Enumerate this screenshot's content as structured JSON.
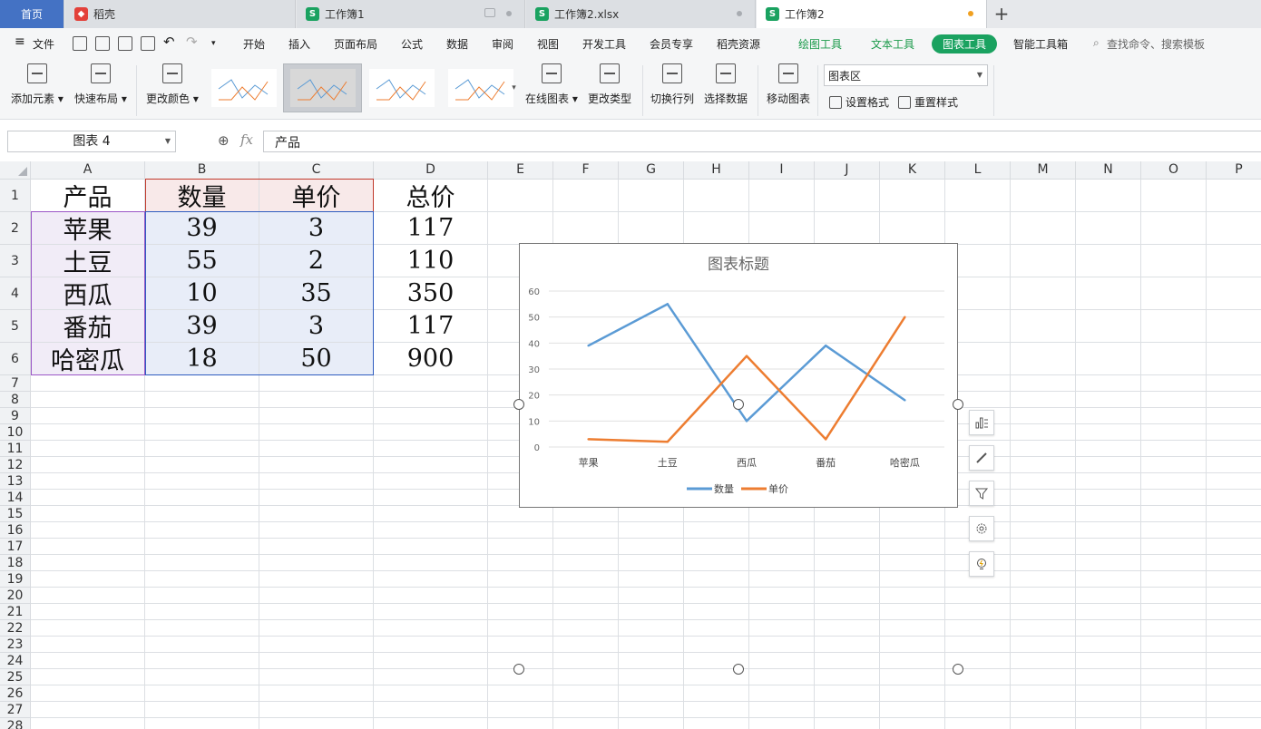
{
  "tabs": [
    {
      "label": "首页"
    },
    {
      "label": "稻壳"
    },
    {
      "label": "工作簿1"
    },
    {
      "label": "工作簿2.xlsx"
    },
    {
      "label": "工作簿2"
    }
  ],
  "menu": {
    "file": "文件",
    "items": [
      "开始",
      "插入",
      "页面布局",
      "公式",
      "数据",
      "审阅",
      "视图",
      "开发工具",
      "会员专享",
      "稻壳资源"
    ],
    "context": [
      "绘图工具",
      "文本工具",
      "图表工具"
    ],
    "smart": "智能工具箱",
    "search": "查找命令、搜索模板"
  },
  "ribbon": {
    "add_element": "添加元素",
    "quick_layout": "快速布局",
    "change_color": "更改颜色",
    "online_chart": "在线图表",
    "change_type": "更改类型",
    "switch_rowcol": "切换行列",
    "select_data": "选择数据",
    "move_chart": "移动图表",
    "chart_area": "图表区",
    "set_format": "设置格式",
    "reset_style": "重置样式"
  },
  "namebox": "图表 4",
  "fx": "fx",
  "formula": "产品",
  "columns": [
    "A",
    "B",
    "C",
    "D",
    "E",
    "F",
    "G",
    "H",
    "I",
    "J",
    "K",
    "L",
    "M",
    "N",
    "O",
    "P"
  ],
  "rows": [
    "1",
    "2",
    "3",
    "4",
    "5",
    "6",
    "7",
    "8",
    "9",
    "10",
    "11",
    "12",
    "13",
    "14",
    "15",
    "16",
    "17",
    "18",
    "19",
    "20",
    "21",
    "22",
    "23",
    "24",
    "25",
    "26",
    "27",
    "28"
  ],
  "table": [
    [
      "产品",
      "数量",
      "单价",
      "总价"
    ],
    [
      "苹果",
      "39",
      "3",
      "117"
    ],
    [
      "土豆",
      "55",
      "2",
      "110"
    ],
    [
      "西瓜",
      "10",
      "35",
      "350"
    ],
    [
      "番茄",
      "39",
      "3",
      "117"
    ],
    [
      "哈密瓜",
      "18",
      "50",
      "900"
    ]
  ],
  "chart_data": {
    "type": "line",
    "title": "图表标题",
    "categories": [
      "苹果",
      "土豆",
      "西瓜",
      "番茄",
      "哈密瓜"
    ],
    "series": [
      {
        "name": "数量",
        "values": [
          39,
          55,
          10,
          39,
          18
        ],
        "color": "#5b9bd5"
      },
      {
        "name": "单价",
        "values": [
          3,
          2,
          35,
          3,
          50
        ],
        "color": "#ed7d31"
      }
    ],
    "yticks": [
      "0",
      "10",
      "20",
      "30",
      "40",
      "50",
      "60"
    ],
    "ylim": [
      0,
      60
    ],
    "grid": true,
    "legend": "bottom"
  }
}
